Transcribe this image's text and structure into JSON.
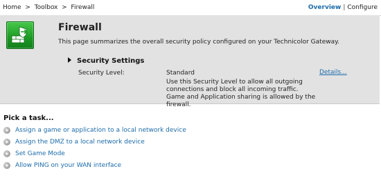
{
  "breadcrumb": {
    "items": [
      "Home",
      "Toolbox",
      "Firewall"
    ],
    "separator": ">"
  },
  "view_switch": {
    "overview": "Overview",
    "separator": "|",
    "configure": "Configure"
  },
  "header": {
    "title": "Firewall",
    "description": "This page summarizes the overall security policy configured on your Technicolor Gateway.",
    "icon": "firewall-shield-icon",
    "icon_color": "#2aa32f"
  },
  "security_settings": {
    "heading": "Security Settings",
    "level_label": "Security Level:",
    "level_value": "Standard",
    "details_link": "Details...",
    "level_description": "Use this Security Level to allow all outgoing connections and block all incoming traffic. Game and Application sharing is allowed by the firewall."
  },
  "tasks": {
    "title": "Pick a task...",
    "items": [
      {
        "label": "Assign a game or application to a local network device"
      },
      {
        "label": "Assign the DMZ to a local network device"
      },
      {
        "label": "Set Game Mode"
      },
      {
        "label": "Allow PING on your WAN interface"
      }
    ]
  },
  "colors": {
    "link": "#1b6bab",
    "panel_bg": "#e2e2e2"
  }
}
